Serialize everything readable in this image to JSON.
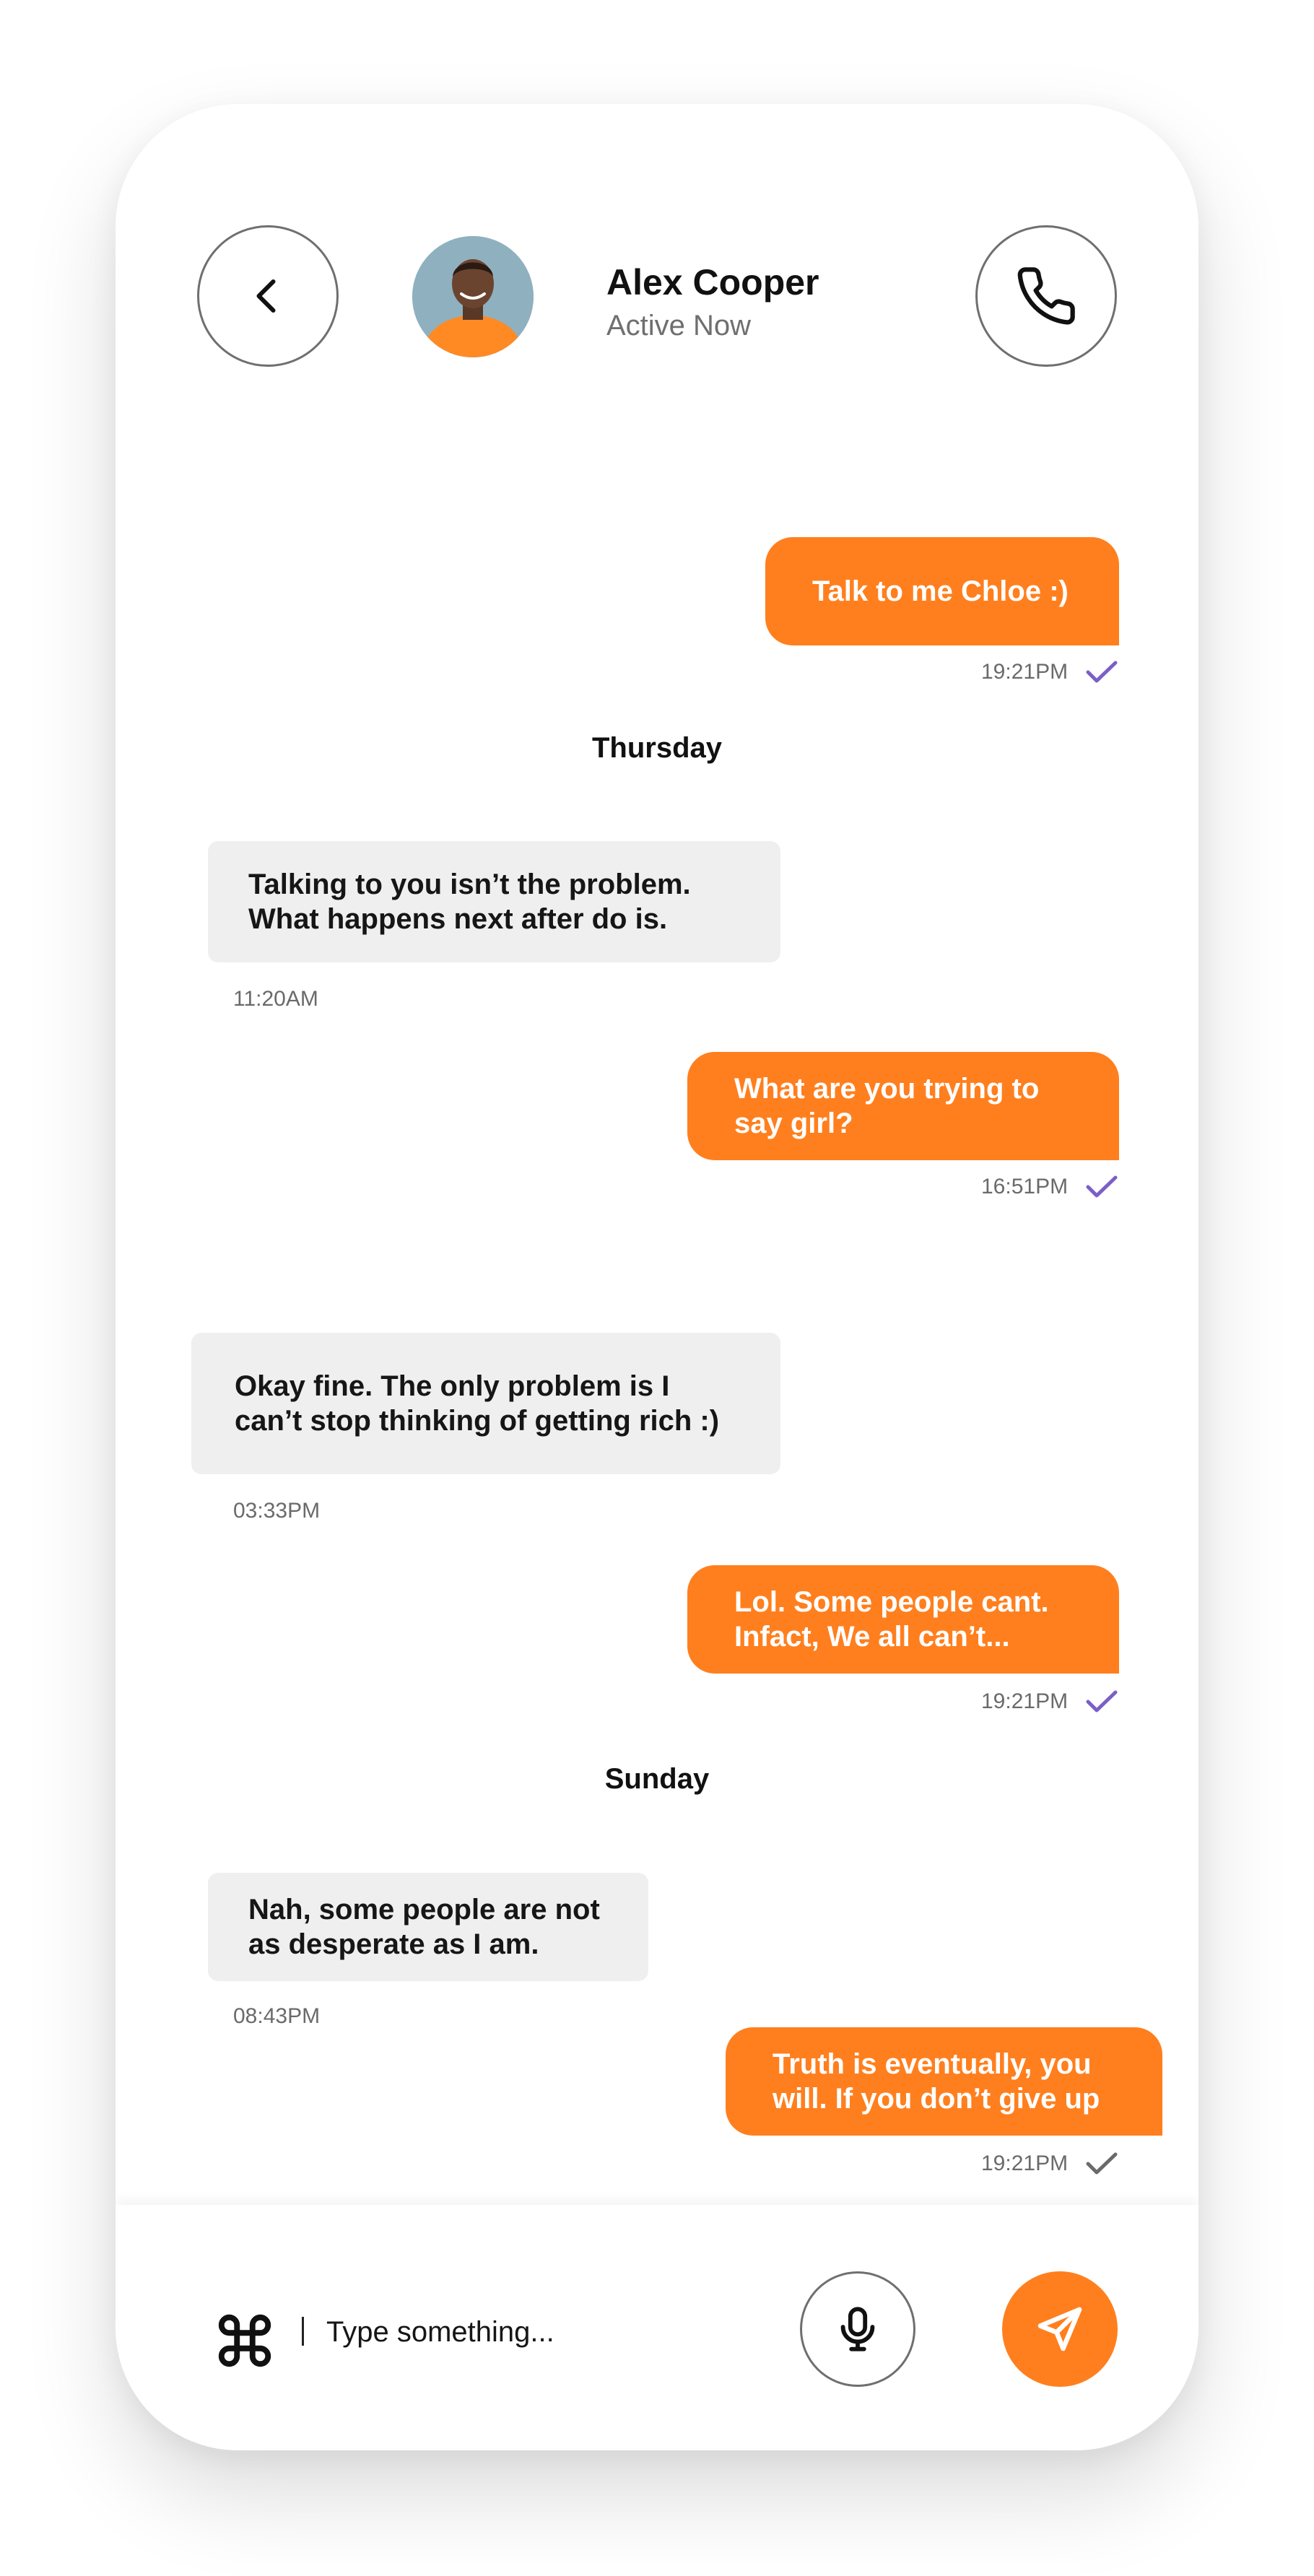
{
  "header": {
    "name": "Alex Cooper",
    "status": "Active Now",
    "icons": {
      "back": "chevron-left-icon",
      "call": "phone-icon"
    }
  },
  "messages": [
    {
      "type": "out",
      "text": "Talk to me Chloe :)",
      "time": "19:21PM",
      "read": true
    },
    {
      "type": "day",
      "text": "Thursday"
    },
    {
      "type": "in",
      "text": "Talking to you isn’t the problem. What happens next after do is.",
      "time": "11:20AM"
    },
    {
      "type": "out",
      "text": "What are you trying to say girl?",
      "time": "16:51PM",
      "read": true
    },
    {
      "type": "in",
      "text": "Okay fine. The only problem is I can’t stop thinking of getting rich :)",
      "time": "03:33PM"
    },
    {
      "type": "out",
      "text": "Lol. Some people cant. Infact, We all can’t...",
      "time": "19:21PM",
      "read": true
    },
    {
      "type": "day",
      "text": "Sunday"
    },
    {
      "type": "in",
      "text": "Nah, some people are not as desperate as I am.",
      "time": "08:43PM"
    },
    {
      "type": "out",
      "text": "Truth is eventually, you will. If you don’t give up",
      "time": "19:21PM",
      "read": false
    }
  ],
  "composer": {
    "placeholder": "Type something...",
    "icons": {
      "command": "command-icon",
      "mic": "microphone-icon",
      "send": "send-icon"
    }
  },
  "colors": {
    "accent": "#ff7f1e",
    "read_check": "#7b5fc7",
    "sent_check": "#6a6a6a",
    "incoming_bg": "#efefef"
  }
}
